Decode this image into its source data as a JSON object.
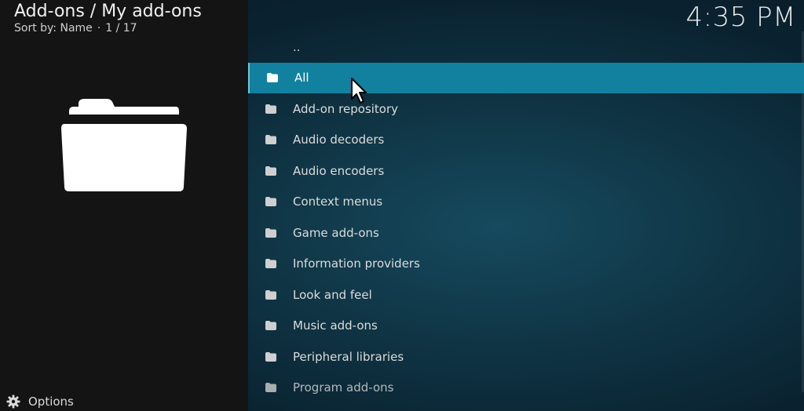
{
  "header": {
    "title": "Add-ons / My add-ons",
    "sort_label": "Sort by: Name",
    "separator": "·",
    "position": "1 / 17"
  },
  "clock": "4:35 PM",
  "left_panel": {
    "preview_icon": "folder-icon"
  },
  "list": {
    "parent_label": "..",
    "selected_index": 0,
    "items": [
      {
        "label": "All",
        "icon": "folder-icon"
      },
      {
        "label": "Add-on repository",
        "icon": "folder-icon"
      },
      {
        "label": "Audio decoders",
        "icon": "folder-icon"
      },
      {
        "label": "Audio encoders",
        "icon": "folder-icon"
      },
      {
        "label": "Context menus",
        "icon": "folder-icon"
      },
      {
        "label": "Game add-ons",
        "icon": "folder-icon"
      },
      {
        "label": "Information providers",
        "icon": "folder-icon"
      },
      {
        "label": "Look and feel",
        "icon": "folder-icon"
      },
      {
        "label": "Music add-ons",
        "icon": "folder-icon"
      },
      {
        "label": "Peripheral libraries",
        "icon": "folder-icon"
      },
      {
        "label": "Program add-ons",
        "icon": "folder-icon"
      }
    ]
  },
  "footer": {
    "options_label": "Options",
    "options_icon": "gear-icon"
  },
  "colors": {
    "selected_bg": "#12809f",
    "left_panel_bg": "#141414",
    "background": "#0f3444"
  }
}
